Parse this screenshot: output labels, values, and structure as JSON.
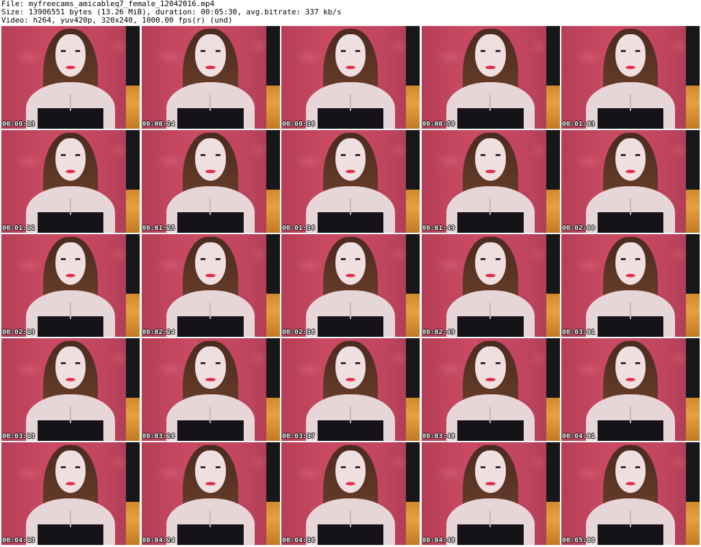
{
  "header": {
    "file_line": "File: myfreecams_amicableq7_female_12042016.mp4",
    "size_line": "Size: 13906551 bytes (13.26 MiB), duration: 00:05:30, avg.bitrate: 337 kb/s",
    "video_line": "Video: h264, yuv420p, 320x240, 1000.00 fps(r) (und)"
  },
  "thumbnails": [
    {
      "timestamp": "00:00:13"
    },
    {
      "timestamp": "00:00:24"
    },
    {
      "timestamp": "00:00:36"
    },
    {
      "timestamp": "00:00:50"
    },
    {
      "timestamp": "00:01:03"
    },
    {
      "timestamp": "00:01:12"
    },
    {
      "timestamp": "00:01:25"
    },
    {
      "timestamp": "00:01:36"
    },
    {
      "timestamp": "00:01:49"
    },
    {
      "timestamp": "00:02:00"
    },
    {
      "timestamp": "00:02:13"
    },
    {
      "timestamp": "00:02:24"
    },
    {
      "timestamp": "00:02:36"
    },
    {
      "timestamp": "00:02:49"
    },
    {
      "timestamp": "00:03:01"
    },
    {
      "timestamp": "00:03:13"
    },
    {
      "timestamp": "00:03:26"
    },
    {
      "timestamp": "00:03:37"
    },
    {
      "timestamp": "00:03:48"
    },
    {
      "timestamp": "00:04:01"
    },
    {
      "timestamp": "00:04:13"
    },
    {
      "timestamp": "00:04:24"
    },
    {
      "timestamp": "00:04:36"
    },
    {
      "timestamp": "00:04:48"
    },
    {
      "timestamp": "00:05:00"
    }
  ]
}
